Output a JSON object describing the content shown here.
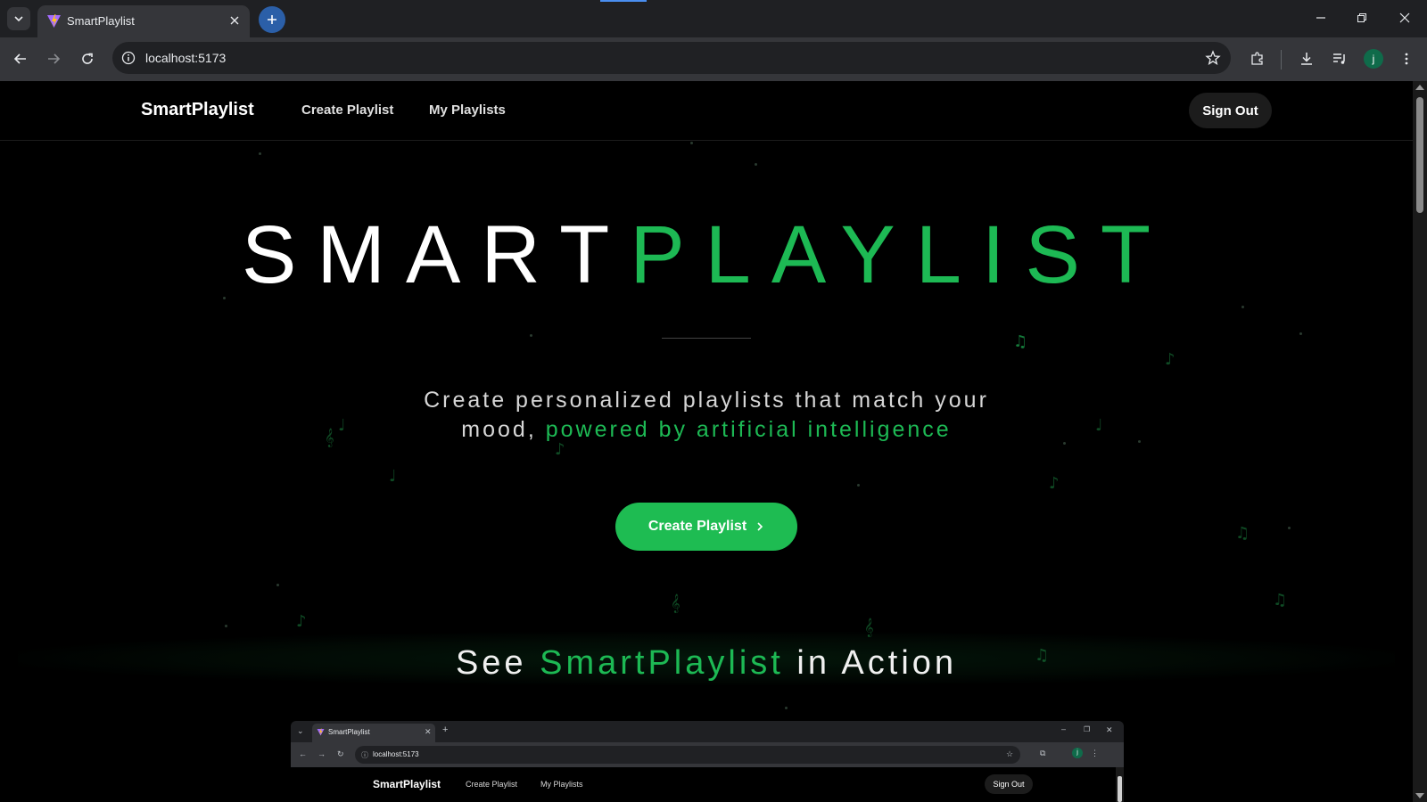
{
  "browser": {
    "tab_title": "SmartPlaylist",
    "url": "localhost:5173",
    "profile_initial": "j"
  },
  "site": {
    "brand": "SmartPlaylist",
    "nav": {
      "create_playlist": "Create Playlist",
      "my_playlists": "My Playlists",
      "sign_out": "Sign Out"
    },
    "hero": {
      "title_white": "SMART",
      "title_green": "PLAYLIST",
      "subtitle_line1": "Create personalized playlists that match your",
      "subtitle_line2_prefix": "mood, ",
      "subtitle_line2_accent": "powered by artificial intelligence",
      "cta_label": "Create Playlist",
      "cta_icon": "chevron-right-icon"
    },
    "action": {
      "prefix": "See ",
      "accent": "SmartPlaylist",
      "suffix": " in Action"
    },
    "preview": {
      "tab_title": "SmartPlaylist",
      "url": "localhost:5173",
      "brand": "SmartPlaylist",
      "create_playlist": "Create Playlist",
      "my_playlists": "My Playlists",
      "sign_out": "Sign Out",
      "profile_initial": "j"
    }
  },
  "colors": {
    "accent_green": "#1db954",
    "cta_green": "#1ebc52",
    "background": "#000000",
    "chrome_dark": "#202124",
    "chrome_toolbar": "#35363a"
  }
}
